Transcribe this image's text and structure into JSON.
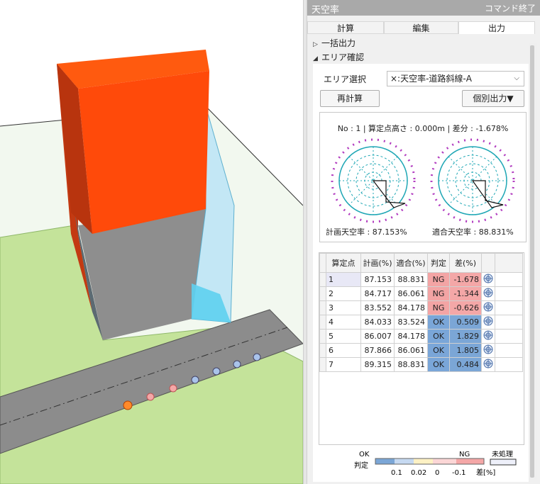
{
  "panel": {
    "title": "天空率",
    "command_end": "コマンド終了",
    "tabs": [
      "計算",
      "編集",
      "出力"
    ],
    "active_tab": "出力",
    "sections": [
      {
        "label": "一括出力",
        "expanded": false
      },
      {
        "label": "エリア確認",
        "expanded": true
      }
    ],
    "area_select_label": "エリア選択",
    "area_select_value": "×:天空率-道路斜線-A",
    "recalc_button": "再計算",
    "individual_output_button": "個別出力▼",
    "info_line": "No : 1 | 算定点高さ : 0.000m | 差分 : -1.678%",
    "plan_sky_ratio": "計画天空率 : 87.153%",
    "compliant_sky_ratio": "適合天空率 : 88.831%"
  },
  "table": {
    "headers": [
      "算定点",
      "計画(%)",
      "適合(%)",
      "判定",
      "差(%)"
    ],
    "rows": [
      {
        "no": "1",
        "plan": "87.153",
        "fit": "88.831",
        "judge": "NG",
        "diff": "-1.678"
      },
      {
        "no": "2",
        "plan": "84.717",
        "fit": "86.061",
        "judge": "NG",
        "diff": "-1.344"
      },
      {
        "no": "3",
        "plan": "83.552",
        "fit": "84.178",
        "judge": "NG",
        "diff": "-0.626"
      },
      {
        "no": "4",
        "plan": "84.033",
        "fit": "83.524",
        "judge": "OK",
        "diff": "0.509"
      },
      {
        "no": "5",
        "plan": "86.007",
        "fit": "84.178",
        "judge": "OK",
        "diff": "1.829"
      },
      {
        "no": "6",
        "plan": "87.866",
        "fit": "86.061",
        "judge": "OK",
        "diff": "1.805"
      },
      {
        "no": "7",
        "plan": "89.315",
        "fit": "88.831",
        "judge": "OK",
        "diff": "0.484"
      }
    ]
  },
  "legend": {
    "judge_label": "判定",
    "ok_label": "OK",
    "ng_label": "NG",
    "unprocessed_label": "未処理",
    "ticks": [
      "0.1",
      "0.02",
      "0",
      "-0.1"
    ],
    "diff_label": "差[%]"
  },
  "colors": {
    "building_top": "#ff5a0f",
    "building_side": "#c33a12",
    "ground": "#c4e39a",
    "road": "#8c8c8c",
    "ok": "#7aa6d8",
    "ng": "#f3a4a4"
  }
}
